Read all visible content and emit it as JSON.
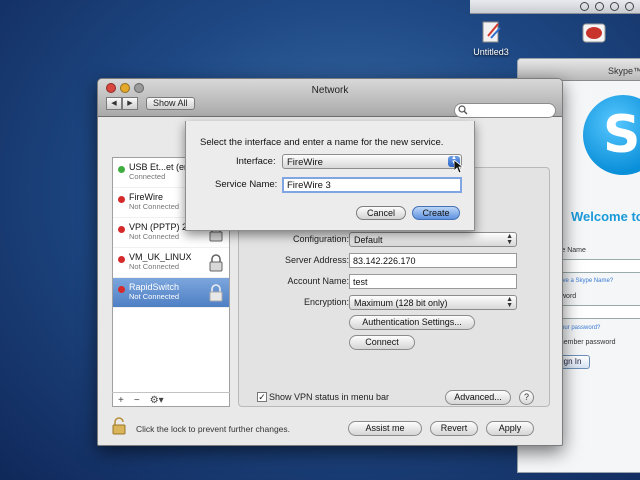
{
  "desktop": {
    "icons": [
      {
        "label": "Untitled3"
      },
      {
        "label": ""
      }
    ]
  },
  "network_window": {
    "title": "Network",
    "show_all_label": "Show All",
    "search_placeholder": "",
    "services": [
      {
        "name": "USB Et...et (en3)",
        "status": "Connected",
        "status_color": "#3fae3f",
        "locked": false,
        "selected": false
      },
      {
        "name": "FireWire",
        "status": "Not Connected",
        "status_color": "#d62a2a",
        "locked": false,
        "selected": false
      },
      {
        "name": "VPN (PPTP) 2",
        "status": "Not Connected",
        "status_color": "#d62a2a",
        "locked": true,
        "selected": false
      },
      {
        "name": "VM_UK_LINUX",
        "status": "Not Connected",
        "status_color": "#d62a2a",
        "locked": true,
        "selected": false
      },
      {
        "name": "RapidSwitch",
        "status": "Not Connected",
        "status_color": "#d62a2a",
        "locked": true,
        "selected": true
      }
    ],
    "list_tools": {
      "add": "+",
      "remove": "−",
      "action": "⚙▾"
    },
    "detail": {
      "configuration_label": "Configuration:",
      "configuration_value": "Default",
      "server_address_label": "Server Address:",
      "server_address_value": "83.142.226.170",
      "account_name_label": "Account Name:",
      "account_name_value": "test",
      "encryption_label": "Encryption:",
      "encryption_value": "Maximum (128 bit only)",
      "auth_settings_label": "Authentication Settings...",
      "connect_label": "Connect",
      "show_vpn_label": "Show VPN status in menu bar",
      "show_vpn_checked": true,
      "advanced_label": "Advanced...",
      "help_label": "?"
    },
    "footer": {
      "lock_text": "Click the lock to prevent further changes.",
      "assist_label": "Assist me",
      "revert_label": "Revert",
      "apply_label": "Apply"
    }
  },
  "sheet": {
    "prompt": "Select the interface and enter a name for the new service.",
    "interface_label": "Interface:",
    "interface_value": "FireWire",
    "service_name_label": "Service Name:",
    "service_name_value": "FireWire 3",
    "cancel_label": "Cancel",
    "create_label": "Create"
  },
  "skype": {
    "title": "Skype™",
    "welcome": "Welcome to S",
    "skype_name_label": "ype Name",
    "no_name_link": "n't have a Skype Name?",
    "password_label": "ssword",
    "forgot_link": "got your password?",
    "remember_label": "emember password",
    "sign_in_label": "Sign In"
  },
  "colors": {
    "desktop": "#1f4a86",
    "accent": "#4e7fc4",
    "skype_blue": "#1a9ad9"
  }
}
